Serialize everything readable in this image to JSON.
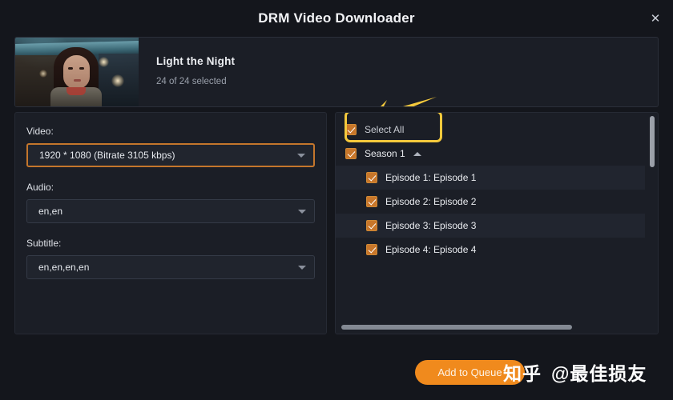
{
  "window": {
    "title": "DRM Video Downloader",
    "close_label": "✕",
    "close_icon": "close-icon"
  },
  "header": {
    "show_title": "Light the Night",
    "selected_text": "24 of 24 selected",
    "thumbnail_alt": "Light the Night poster frame",
    "annotation_arrow": "yellow-arrow-pointing-left"
  },
  "left_panel": {
    "fields": [
      {
        "label": "Video:",
        "value": "1920 * 1080 (Bitrate 3105 kbps)",
        "highlighted": true
      },
      {
        "label": "Audio:",
        "value": "en,en",
        "highlighted": false
      },
      {
        "label": "Subtitle:",
        "value": "en,en,en,en",
        "highlighted": false
      }
    ],
    "caret_icon": "chevron-down-icon"
  },
  "right_panel": {
    "select_all": {
      "label": "Select All",
      "checked": true,
      "highlighted": true
    },
    "season": {
      "label": "Season 1",
      "checked": true,
      "collapse_icon": "chevron-up-icon"
    },
    "episodes": [
      {
        "label": "Episode 1: Episode 1",
        "checked": true
      },
      {
        "label": "Episode 2: Episode 2",
        "checked": true
      },
      {
        "label": "Episode 3: Episode 3",
        "checked": true
      },
      {
        "label": "Episode 4: Episode 4",
        "checked": true
      }
    ],
    "vertical_scrollbar": "visible",
    "horizontal_scrollbar": "visible"
  },
  "footer": {
    "add_to_queue_label": "Add to Queue"
  },
  "watermark": {
    "brand": "知乎",
    "handle": "@最佳损友"
  },
  "colors": {
    "accent_orange": "#f08a1d",
    "checkbox_orange": "#c8762a",
    "annotation_yellow": "#f4c93c",
    "highlight_border": "#c4762c",
    "panel_bg": "#1b1e26",
    "window_bg": "#14161c"
  }
}
